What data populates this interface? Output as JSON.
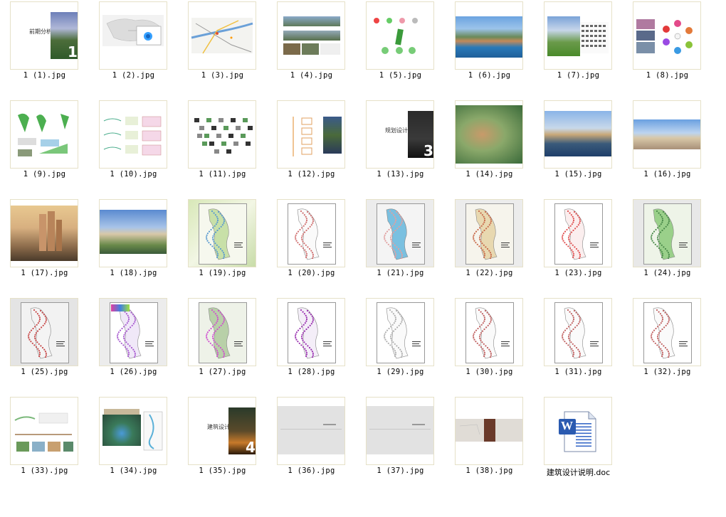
{
  "files": [
    {
      "name": "1 (1).jpg"
    },
    {
      "name": "1 (2).jpg"
    },
    {
      "name": "1 (3).jpg"
    },
    {
      "name": "1 (4).jpg"
    },
    {
      "name": "1 (5).jpg"
    },
    {
      "name": "1 (6).jpg"
    },
    {
      "name": "1 (7).jpg"
    },
    {
      "name": "1 (8).jpg"
    },
    {
      "name": "1 (9).jpg"
    },
    {
      "name": "1 (10).jpg"
    },
    {
      "name": "1 (11).jpg"
    },
    {
      "name": "1 (12).jpg"
    },
    {
      "name": "1 (13).jpg"
    },
    {
      "name": "1 (14).jpg"
    },
    {
      "name": "1 (15).jpg"
    },
    {
      "name": "1 (16).jpg"
    },
    {
      "name": "1 (17).jpg"
    },
    {
      "name": "1 (18).jpg"
    },
    {
      "name": "1 (19).jpg"
    },
    {
      "name": "1 (20).jpg"
    },
    {
      "name": "1 (21).jpg"
    },
    {
      "name": "1 (22).jpg"
    },
    {
      "name": "1 (23).jpg"
    },
    {
      "name": "1 (24).jpg"
    },
    {
      "name": "1 (25).jpg"
    },
    {
      "name": "1 (26).jpg"
    },
    {
      "name": "1 (27).jpg"
    },
    {
      "name": "1 (28).jpg"
    },
    {
      "name": "1 (29).jpg"
    },
    {
      "name": "1 (30).jpg"
    },
    {
      "name": "1 (31).jpg"
    },
    {
      "name": "1 (32).jpg"
    },
    {
      "name": "1 (33).jpg"
    },
    {
      "name": "1 (34).jpg"
    },
    {
      "name": "1 (35).jpg"
    },
    {
      "name": "1 (36).jpg"
    },
    {
      "name": "1 (37).jpg"
    },
    {
      "name": "1 (38).jpg"
    },
    {
      "name": "建筑设计说明.doc",
      "icon": "word-document-icon"
    }
  ],
  "thumb_text": {
    "t1_title": "前期分析",
    "t1_num": "1",
    "t13_title": "规划设计",
    "t13_num": "3",
    "t35_title": "建筑设计",
    "t35_num": "4",
    "doc_letter": "W"
  }
}
